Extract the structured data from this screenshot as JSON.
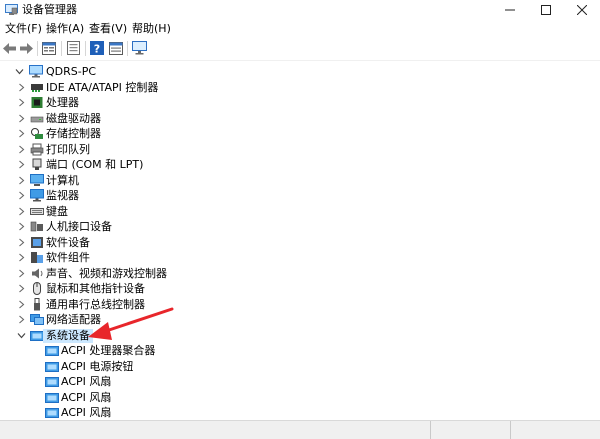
{
  "window": {
    "title": "设备管理器"
  },
  "menu": [
    {
      "id": "file",
      "label": "文件(F)"
    },
    {
      "id": "action",
      "label": "操作(A)"
    },
    {
      "id": "view",
      "label": "查看(V)"
    },
    {
      "id": "help",
      "label": "帮助(H)"
    }
  ],
  "toolbar": [
    "back-icon",
    "forward-icon",
    "device-list-icon",
    "properties-icon",
    "help-icon",
    "view-icon",
    "monitor-icon"
  ],
  "tree": {
    "root": "QDRS-PC",
    "categories": [
      {
        "label": "IDE ATA/ATAPI 控制器",
        "icon": "ide-controller-icon"
      },
      {
        "label": "处理器",
        "icon": "processor-icon"
      },
      {
        "label": "磁盘驱动器",
        "icon": "disk-drive-icon"
      },
      {
        "label": "存储控制器",
        "icon": "storage-controller-icon"
      },
      {
        "label": "打印队列",
        "icon": "printer-icon"
      },
      {
        "label": "端口 (COM 和 LPT)",
        "icon": "port-icon"
      },
      {
        "label": "计算机",
        "icon": "computer-icon"
      },
      {
        "label": "监视器",
        "icon": "monitor-icon"
      },
      {
        "label": "键盘",
        "icon": "keyboard-icon"
      },
      {
        "label": "人机接口设备",
        "icon": "hid-icon"
      },
      {
        "label": "软件设备",
        "icon": "software-device-icon"
      },
      {
        "label": "软件组件",
        "icon": "software-component-icon"
      },
      {
        "label": "声音、视频和游戏控制器",
        "icon": "sound-icon"
      },
      {
        "label": "鼠标和其他指针设备",
        "icon": "mouse-icon"
      },
      {
        "label": "通用串行总线控制器",
        "icon": "usb-icon"
      },
      {
        "label": "网络适配器",
        "icon": "network-adapter-icon"
      },
      {
        "label": "系统设备",
        "icon": "system-device-icon",
        "expanded": true,
        "selected": true
      }
    ],
    "children": [
      {
        "label": "ACPI 处理器聚合器"
      },
      {
        "label": "ACPI 电源按钮"
      },
      {
        "label": "ACPI 风扇"
      },
      {
        "label": "ACPI 风扇"
      },
      {
        "label": "ACPI 风扇"
      }
    ]
  },
  "colors": {
    "selection": "#cce8ff",
    "annotation": "#e8262b",
    "accent": "#1e73d8"
  }
}
